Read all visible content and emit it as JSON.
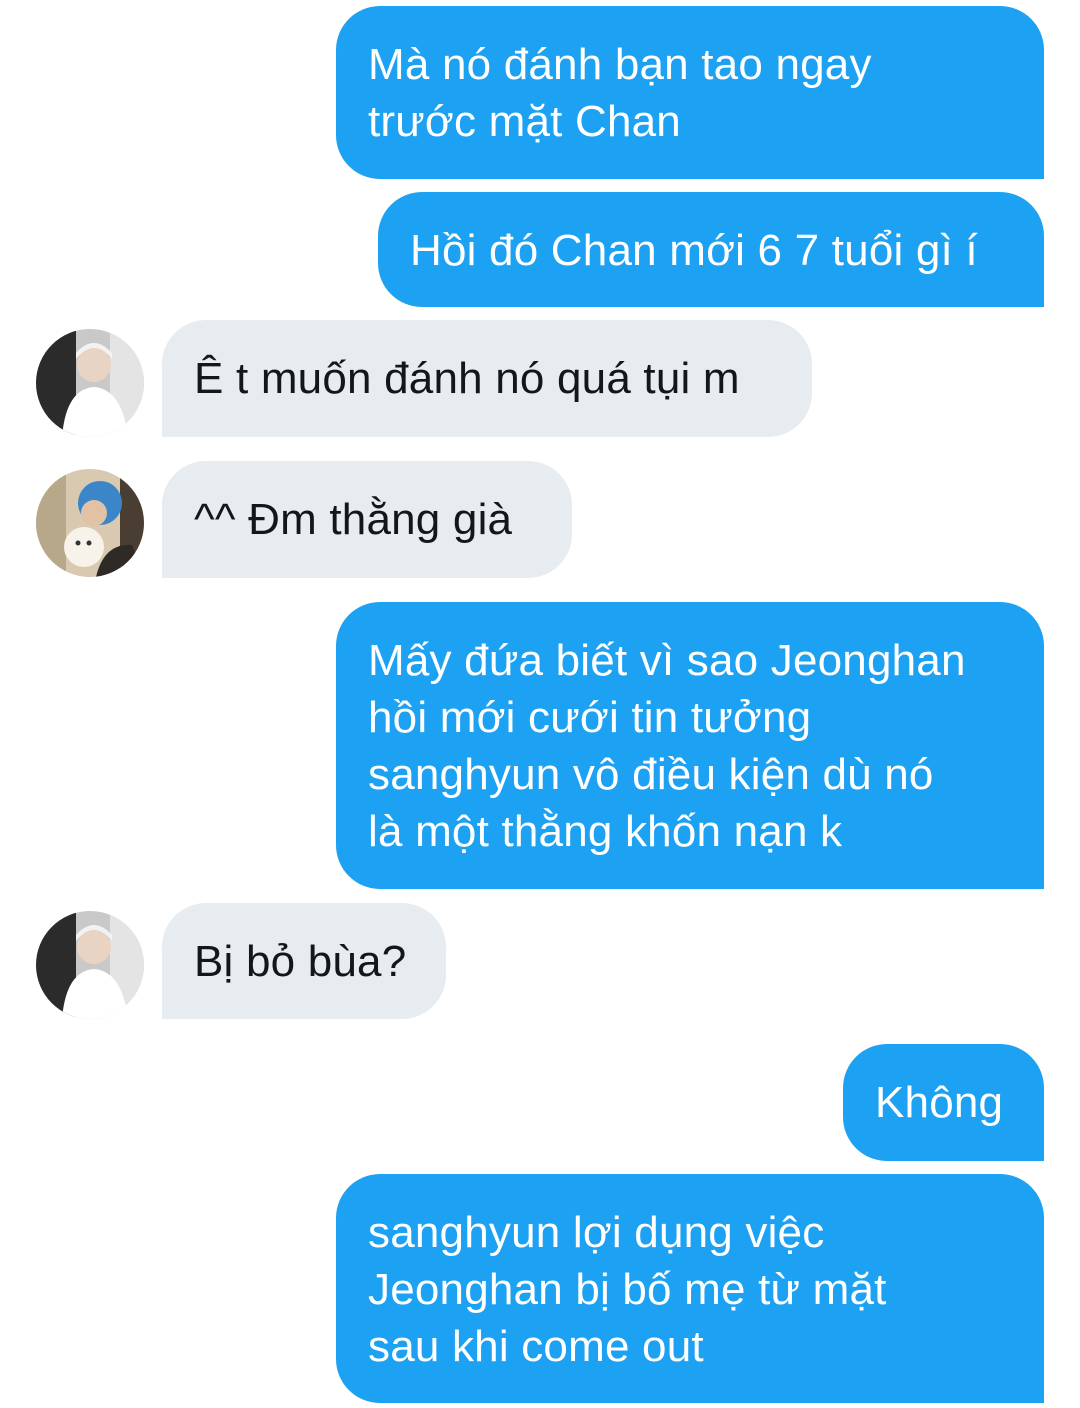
{
  "messages": [
    {
      "side": "out",
      "text": "Mà nó đánh bạn tao ngay\ntrước mặt Chan"
    },
    {
      "side": "out",
      "text": "Hồi đó Chan mới 6 7 tuổi gì í"
    },
    {
      "side": "in",
      "avatar": "avatar-a",
      "text": "Ê t muốn đánh nó quá tụi m"
    },
    {
      "side": "in",
      "avatar": "avatar-b",
      "text": "^^ Đm thằng già"
    },
    {
      "side": "out",
      "text": "Mấy đứa biết vì sao Jeonghan\nhồi mới cưới tin tưởng\nsanghyun vô điều kiện dù nó\nlà một thằng khốn nạn k"
    },
    {
      "side": "in",
      "avatar": "avatar-a",
      "text": "Bị bỏ bùa?"
    },
    {
      "side": "out",
      "text": "Không"
    },
    {
      "side": "out",
      "text": "sanghyun lợi dụng việc\nJeonghan bị bố mẹ từ mặt\nsau khi come out"
    }
  ],
  "colors": {
    "outgoing_bubble": "#1da1f2",
    "incoming_bubble": "#e6ecf0",
    "incoming_text": "#14171a",
    "background": "#ffffff"
  }
}
